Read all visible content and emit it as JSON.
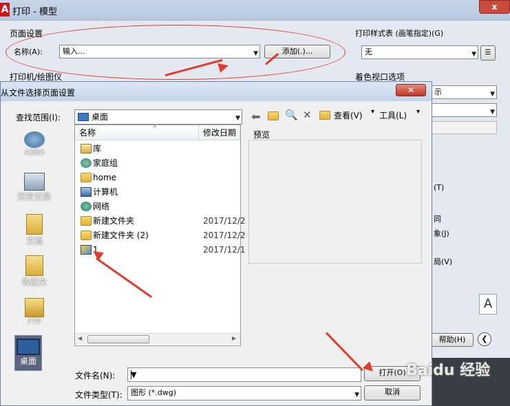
{
  "background_window": {
    "title": "打印 - 模型",
    "close_label": "x",
    "page_setup": {
      "group_title": "页面设置",
      "name_label": "名称(A):",
      "name_value": "输入...",
      "add_button": "添加(.)..."
    },
    "printer_group": "打印机/绘图仪",
    "plot_style": {
      "group_title": "打印样式表 (画笔指定)(G)",
      "value": "无"
    },
    "shaded_viewport": "着色视口选项",
    "partial_texts": [
      "示",
      "(T)",
      "同",
      "象(J)",
      "局(V)"
    ],
    "help_button": "帮助(H)",
    "a_icon": "A"
  },
  "dialog": {
    "title": "从文件选择页面设置",
    "lookin_label": "查找范围(I):",
    "lookin_value": "桌面",
    "toolbar": {
      "views_label": "查看(V)",
      "tools_label": "工具(L)"
    },
    "places": [
      {
        "label": "A360",
        "icon": "cloud-icon"
      },
      {
        "label": "历史记录",
        "icon": "history-icon"
      },
      {
        "label": "文档",
        "icon": "documents-icon"
      },
      {
        "label": "收藏夹",
        "icon": "favorites-icon"
      },
      {
        "label": "FTP",
        "icon": "ftp-icon"
      },
      {
        "label": "桌面",
        "icon": "desktop-icon"
      }
    ],
    "columns": [
      "名称",
      "修改日期"
    ],
    "files": [
      {
        "name": "库",
        "date": "",
        "icon": "library-icon"
      },
      {
        "name": "家庭组",
        "date": "",
        "icon": "homegroup-icon"
      },
      {
        "name": "home",
        "date": "",
        "icon": "user-folder-icon"
      },
      {
        "name": "计算机",
        "date": "",
        "icon": "computer-icon"
      },
      {
        "name": "网络",
        "date": "",
        "icon": "network-icon"
      },
      {
        "name": "新建文件夹",
        "date": "2017/12/2",
        "icon": "folder-icon"
      },
      {
        "name": "新建文件夹 (2)",
        "date": "2017/12/2",
        "icon": "folder-icon"
      },
      {
        "name": "1",
        "date": "2017/12/1",
        "icon": "dwg-file-icon"
      }
    ],
    "preview_label": "预览",
    "filename_label": "文件名(N):",
    "filename_value": "",
    "filetype_label": "文件类型(T):",
    "filetype_value": "图形 (*.dwg)",
    "open_button": "打开(O)",
    "cancel_button": "取消"
  },
  "watermark": "Baidu 经验",
  "colors": {
    "annotation_red": "#e03b2b"
  }
}
